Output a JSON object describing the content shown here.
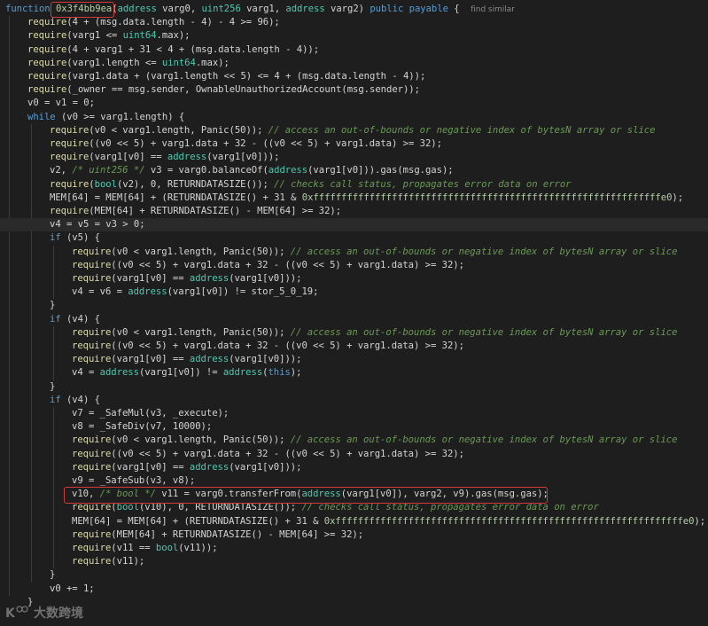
{
  "editor": {
    "find_similar_label": "find similar",
    "colors": {
      "background": "#1e1e1e",
      "keyword": "#569cd6",
      "type": "#4ec9b0",
      "function": "#dcdcaa",
      "number": "#b5cea8",
      "comment": "#6a9955",
      "highlight_box": "#d23b3b"
    },
    "lines": [
      {
        "indent": 0,
        "tokens": [
          [
            "kw",
            "function "
          ],
          [
            "hex",
            "0x3f4bb9ea"
          ],
          [
            "pl",
            "("
          ],
          [
            "ty",
            "address"
          ],
          [
            "pl",
            " varg0, "
          ],
          [
            "ty",
            "uint256"
          ],
          [
            "pl",
            " varg1, "
          ],
          [
            "ty",
            "address"
          ],
          [
            "pl",
            " varg2) "
          ],
          [
            "kw",
            "public payable"
          ],
          [
            "pl",
            " {  "
          ],
          [
            "hint",
            "find similar"
          ]
        ]
      },
      {
        "indent": 1,
        "tokens": [
          [
            "fn",
            "require"
          ],
          [
            "pl",
            "(4 + (msg.data.length - 4) - 4 >= 96);"
          ]
        ]
      },
      {
        "indent": 1,
        "tokens": [
          [
            "fn",
            "require"
          ],
          [
            "pl",
            "(varg1 <= "
          ],
          [
            "ty",
            "uint64"
          ],
          [
            "pl",
            ".max);"
          ]
        ]
      },
      {
        "indent": 1,
        "tokens": [
          [
            "fn",
            "require"
          ],
          [
            "pl",
            "(4 + varg1 + 31 < 4 + (msg.data.length - 4));"
          ]
        ]
      },
      {
        "indent": 1,
        "tokens": [
          [
            "fn",
            "require"
          ],
          [
            "pl",
            "(varg1.length <= "
          ],
          [
            "ty",
            "uint64"
          ],
          [
            "pl",
            ".max);"
          ]
        ]
      },
      {
        "indent": 1,
        "tokens": [
          [
            "fn",
            "require"
          ],
          [
            "pl",
            "(varg1.data + (varg1.length << 5) <= 4 + (msg.data.length - 4));"
          ]
        ]
      },
      {
        "indent": 1,
        "tokens": [
          [
            "fn",
            "require"
          ],
          [
            "pl",
            "(_owner == msg.sender, OwnableUnauthorizedAccount(msg.sender));"
          ]
        ]
      },
      {
        "indent": 1,
        "tokens": [
          [
            "pl",
            "v0 = v1 = 0;"
          ]
        ]
      },
      {
        "indent": 1,
        "tokens": [
          [
            "kw",
            "while"
          ],
          [
            "pl",
            " (v0 >= varg1.length) {"
          ]
        ]
      },
      {
        "indent": 2,
        "tokens": [
          [
            "fn",
            "require"
          ],
          [
            "pl",
            "(v0 < varg1.length, Panic(50)); "
          ],
          [
            "cm",
            "// access an out-of-bounds or negative index of bytesN array or slice"
          ]
        ]
      },
      {
        "indent": 2,
        "tokens": [
          [
            "fn",
            "require"
          ],
          [
            "pl",
            "((v0 << 5) + varg1.data + 32 - ((v0 << 5) + varg1.data) >= 32);"
          ]
        ]
      },
      {
        "indent": 2,
        "tokens": [
          [
            "fn",
            "require"
          ],
          [
            "pl",
            "(varg1[v0] == "
          ],
          [
            "ty",
            "address"
          ],
          [
            "pl",
            "(varg1[v0]));"
          ]
        ]
      },
      {
        "indent": 2,
        "tokens": [
          [
            "pl",
            "v2, "
          ],
          [
            "cm",
            "/* uint256 */"
          ],
          [
            "pl",
            " v3 = varg0.balanceOf("
          ],
          [
            "ty",
            "address"
          ],
          [
            "pl",
            "(varg1[v0])).gas(msg.gas);"
          ]
        ]
      },
      {
        "indent": 2,
        "tokens": [
          [
            "fn",
            "require"
          ],
          [
            "pl",
            "("
          ],
          [
            "ty",
            "bool"
          ],
          [
            "pl",
            "(v2), 0, RETURNDATASIZE()); "
          ],
          [
            "cm",
            "// checks call status, propagates error data on error"
          ]
        ]
      },
      {
        "indent": 2,
        "tokens": [
          [
            "pl",
            "MEM[64] = MEM[64] + (RETURNDATASIZE() + 31 & "
          ],
          [
            "hex",
            "0xffffffffffffffffffffffffffffffffffffffffffffffffffffffffffffffe0"
          ],
          [
            "pl",
            ");"
          ]
        ]
      },
      {
        "indent": 2,
        "tokens": [
          [
            "fn",
            "require"
          ],
          [
            "pl",
            "(MEM[64] + RETURNDATASIZE() - MEM[64] >= 32);"
          ]
        ]
      },
      {
        "indent": 2,
        "hl": true,
        "tokens": [
          [
            "pl",
            "v4 = v5 = v3 > 0;"
          ]
        ]
      },
      {
        "indent": 2,
        "tokens": [
          [
            "kw",
            "if"
          ],
          [
            "pl",
            " (v5) {"
          ]
        ]
      },
      {
        "indent": 3,
        "tokens": [
          [
            "fn",
            "require"
          ],
          [
            "pl",
            "(v0 < varg1.length, Panic(50)); "
          ],
          [
            "cm",
            "// access an out-of-bounds or negative index of bytesN array or slice"
          ]
        ]
      },
      {
        "indent": 3,
        "tokens": [
          [
            "fn",
            "require"
          ],
          [
            "pl",
            "((v0 << 5) + varg1.data + 32 - ((v0 << 5) + varg1.data) >= 32);"
          ]
        ]
      },
      {
        "indent": 3,
        "tokens": [
          [
            "fn",
            "require"
          ],
          [
            "pl",
            "(varg1[v0] == "
          ],
          [
            "ty",
            "address"
          ],
          [
            "pl",
            "(varg1[v0]));"
          ]
        ]
      },
      {
        "indent": 3,
        "tokens": [
          [
            "pl",
            "v4 = v6 = "
          ],
          [
            "ty",
            "address"
          ],
          [
            "pl",
            "(varg1[v0]) != stor_5_0_19;"
          ]
        ]
      },
      {
        "indent": 2,
        "tokens": [
          [
            "pl",
            "}"
          ]
        ]
      },
      {
        "indent": 2,
        "tokens": [
          [
            "kw",
            "if"
          ],
          [
            "pl",
            " (v4) {"
          ]
        ]
      },
      {
        "indent": 3,
        "tokens": [
          [
            "fn",
            "require"
          ],
          [
            "pl",
            "(v0 < varg1.length, Panic(50)); "
          ],
          [
            "cm",
            "// access an out-of-bounds or negative index of bytesN array or slice"
          ]
        ]
      },
      {
        "indent": 3,
        "tokens": [
          [
            "fn",
            "require"
          ],
          [
            "pl",
            "((v0 << 5) + varg1.data + 32 - ((v0 << 5) + varg1.data) >= 32);"
          ]
        ]
      },
      {
        "indent": 3,
        "tokens": [
          [
            "fn",
            "require"
          ],
          [
            "pl",
            "(varg1[v0] == "
          ],
          [
            "ty",
            "address"
          ],
          [
            "pl",
            "(varg1[v0]));"
          ]
        ]
      },
      {
        "indent": 3,
        "tokens": [
          [
            "pl",
            "v4 = "
          ],
          [
            "ty",
            "address"
          ],
          [
            "pl",
            "(varg1[v0]) != "
          ],
          [
            "ty",
            "address"
          ],
          [
            "pl",
            "("
          ],
          [
            "kw",
            "this"
          ],
          [
            "pl",
            ");"
          ]
        ]
      },
      {
        "indent": 2,
        "tokens": [
          [
            "pl",
            "}"
          ]
        ]
      },
      {
        "indent": 2,
        "tokens": [
          [
            "kw",
            "if"
          ],
          [
            "pl",
            " (v4) {"
          ]
        ]
      },
      {
        "indent": 3,
        "tokens": [
          [
            "pl",
            "v7 = _SafeMul(v3, _execute);"
          ]
        ]
      },
      {
        "indent": 3,
        "tokens": [
          [
            "pl",
            "v8 = _SafeDiv(v7, 10000);"
          ]
        ]
      },
      {
        "indent": 3,
        "tokens": [
          [
            "fn",
            "require"
          ],
          [
            "pl",
            "(v0 < varg1.length, Panic(50)); "
          ],
          [
            "cm",
            "// access an out-of-bounds or negative index of bytesN array or slice"
          ]
        ]
      },
      {
        "indent": 3,
        "tokens": [
          [
            "fn",
            "require"
          ],
          [
            "pl",
            "((v0 << 5) + varg1.data + 32 - ((v0 << 5) + varg1.data) >= 32);"
          ]
        ]
      },
      {
        "indent": 3,
        "tokens": [
          [
            "fn",
            "require"
          ],
          [
            "pl",
            "(varg1[v0] == "
          ],
          [
            "ty",
            "address"
          ],
          [
            "pl",
            "(varg1[v0]));"
          ]
        ]
      },
      {
        "indent": 3,
        "tokens": [
          [
            "pl",
            "v9 = _SafeSub(v3, v8);"
          ]
        ]
      },
      {
        "indent": 3,
        "tokens": [
          [
            "pl",
            "v10, "
          ],
          [
            "cm",
            "/* bool */"
          ],
          [
            "pl",
            " v11 = varg0.transferFrom("
          ],
          [
            "ty",
            "address"
          ],
          [
            "pl",
            "(varg1[v0]), varg2, v9).gas(msg.gas);"
          ]
        ]
      },
      {
        "indent": 3,
        "tokens": [
          [
            "fn",
            "require"
          ],
          [
            "pl",
            "("
          ],
          [
            "ty",
            "bool"
          ],
          [
            "pl",
            "(v10), 0, RETURNDATASIZE()); "
          ],
          [
            "cm",
            "// checks call status, propagates error data on error"
          ]
        ]
      },
      {
        "indent": 3,
        "tokens": [
          [
            "pl",
            "MEM[64] = MEM[64] + (RETURNDATASIZE() + 31 & "
          ],
          [
            "hex",
            "0xffffffffffffffffffffffffffffffffffffffffffffffffffffffffffffffe0"
          ],
          [
            "pl",
            ");"
          ]
        ]
      },
      {
        "indent": 3,
        "tokens": [
          [
            "fn",
            "require"
          ],
          [
            "pl",
            "(MEM[64] + RETURNDATASIZE() - MEM[64] >= 32);"
          ]
        ]
      },
      {
        "indent": 3,
        "tokens": [
          [
            "fn",
            "require"
          ],
          [
            "pl",
            "(v11 == "
          ],
          [
            "ty",
            "bool"
          ],
          [
            "pl",
            "(v11));"
          ]
        ]
      },
      {
        "indent": 3,
        "tokens": [
          [
            "fn",
            "require"
          ],
          [
            "pl",
            "(v11);"
          ]
        ]
      },
      {
        "indent": 2,
        "tokens": [
          [
            "pl",
            "}"
          ]
        ]
      },
      {
        "indent": 2,
        "tokens": [
          [
            "pl",
            "v0 += 1;"
          ]
        ]
      },
      {
        "indent": 1,
        "tokens": [
          [
            "pl",
            "}"
          ]
        ]
      }
    ]
  },
  "watermark": {
    "text": "大数跨境",
    "icon": "logo-icon"
  }
}
